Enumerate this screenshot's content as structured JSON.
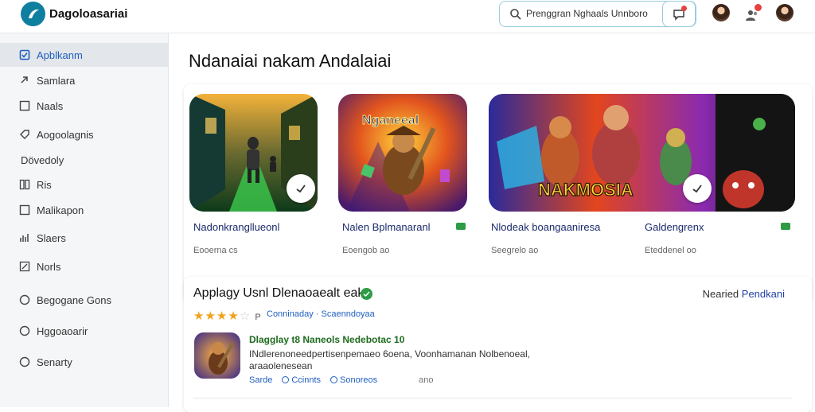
{
  "header": {
    "brand": "Dagoloasariai",
    "search_text": "Prenggran   Nghaals  Unnboro",
    "search_icon": "search-icon",
    "chat_icon": "chat-icon"
  },
  "sidebar": {
    "items": [
      {
        "label": "Apblkanm",
        "icon": "checkbox-icon",
        "active": true
      },
      {
        "label": "Samlara",
        "icon": "link-icon"
      },
      {
        "label": "Naals",
        "icon": "square-icon"
      },
      {
        "label": "Aogoolagnis",
        "icon": "tag-icon"
      },
      {
        "label": "Dövedoly",
        "icon": "none"
      },
      {
        "label": "Ris",
        "icon": "grid-icon"
      },
      {
        "label": "Malikapon",
        "icon": "square-icon"
      },
      {
        "label": "Slaers",
        "icon": "chart-icon"
      },
      {
        "label": "Norls",
        "icon": "edit-icon"
      },
      {
        "label": "Begogane Gons",
        "icon": "circle-icon"
      },
      {
        "label": "Hggoaoarir",
        "icon": "circle-icon"
      },
      {
        "label": "Senarty",
        "icon": "circle-icon"
      }
    ]
  },
  "main": {
    "title": "Ndanaiai nakam Andalaiai",
    "cards": [
      {
        "title": "Nadonkrangllueonl",
        "sub": "Eooerna cs",
        "badge": false
      },
      {
        "title": "Nalen Bplmanaranl",
        "sub": "Eoengob ao",
        "badge": true
      },
      {
        "title": "Nlodeak boangaaniresa",
        "sub": "Seegrelo ao",
        "badge": false
      },
      {
        "title": "Galdengrenx",
        "sub": "Eteddenel oo",
        "badge": true
      }
    ],
    "card_art_text": {
      "card2": "Nganeeal",
      "card3": "NAKMOSIA"
    },
    "detail": {
      "title": "Applagy Usnl Dlenaoaealt eak",
      "related_prefix": "Nearied",
      "related_link": "Pendkani",
      "rating": 3.5,
      "stars_text": "★★★★",
      "stars_off": "☆",
      "rating_num": "P",
      "link1": "Conninaday",
      "link2": "Scaenndoyaa",
      "app_name": "Dlagglay t8 Naneols Nedebotac 10",
      "app_desc": "INdlerenoneedpertisenpemaeo 6oena, Voonhamanan Nolbenoeal, araaolenesean",
      "actions": [
        "Sarde",
        "Ccinnts",
        "Sonoreos"
      ],
      "extra": "ano"
    }
  }
}
